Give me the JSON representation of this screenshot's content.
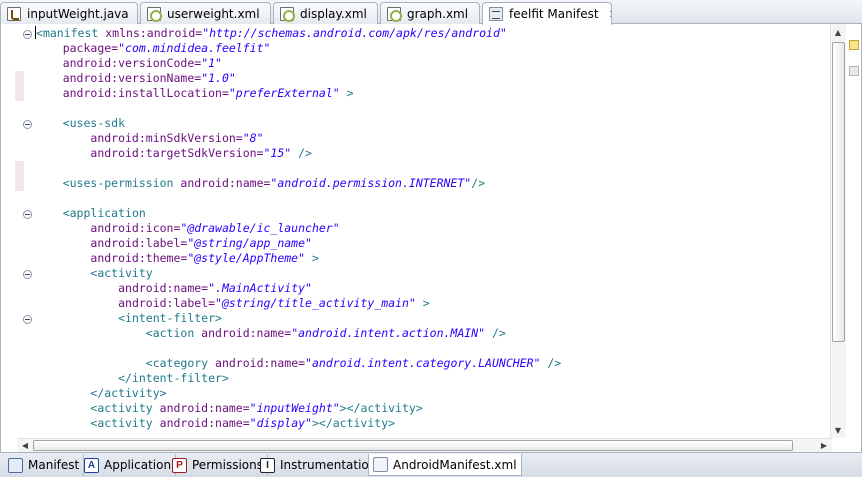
{
  "editor_tabs": [
    {
      "label": "inputWeight.java",
      "icon": "java-file-icon"
    },
    {
      "label": "userweight.xml",
      "icon": "xml-file-icon"
    },
    {
      "label": "display.xml",
      "icon": "xml-file-icon"
    },
    {
      "label": "graph.xml",
      "icon": "xml-file-icon"
    },
    {
      "label": "feelfit Manifest",
      "icon": "manifest-file-icon",
      "active": true,
      "close": "✕"
    }
  ],
  "code": {
    "lines": [
      [
        "<",
        "manifest ",
        "xmlns:android=",
        "\"http://schemas.android.com/apk/res/android\"",
        ""
      ],
      [
        "    ",
        "",
        "package=",
        "\"com.mindidea.feelfit\"",
        ""
      ],
      [
        "    ",
        "",
        "android:versionCode=",
        "\"1\"",
        ""
      ],
      [
        "    ",
        "",
        "android:versionName=",
        "\"1.0\"",
        ""
      ],
      [
        "    ",
        "",
        "android:installLocation=",
        "\"preferExternal\"",
        " >"
      ],
      [
        "",
        "",
        "",
        "",
        ""
      ],
      [
        "    ",
        "<uses-sdk",
        "",
        "",
        ""
      ],
      [
        "        ",
        "",
        "android:minSdkVersion=",
        "\"8\"",
        ""
      ],
      [
        "        ",
        "",
        "android:targetSdkVersion=",
        "\"15\"",
        " />"
      ],
      [
        "",
        "",
        "",
        "",
        ""
      ],
      [
        "    ",
        "<uses-permission ",
        "android:name=",
        "\"android.permission.INTERNET\"",
        "/>"
      ],
      [
        "",
        "",
        "",
        "",
        ""
      ],
      [
        "    ",
        "<application",
        "",
        "",
        ""
      ],
      [
        "        ",
        "",
        "android:icon=",
        "\"@drawable/ic_launcher\"",
        ""
      ],
      [
        "        ",
        "",
        "android:label=",
        "\"@string/app_name\"",
        ""
      ],
      [
        "        ",
        "",
        "android:theme=",
        "\"@style/AppTheme\"",
        " >"
      ],
      [
        "        ",
        "<activity",
        "",
        "",
        ""
      ],
      [
        "            ",
        "",
        "android:name=",
        "\".MainActivity\"",
        ""
      ],
      [
        "            ",
        "",
        "android:label=",
        "\"@string/title_activity_main\"",
        " >"
      ],
      [
        "            ",
        "<intent-filter>",
        "",
        "",
        ""
      ],
      [
        "                ",
        "<action ",
        "android:name=",
        "\"android.intent.action.MAIN\"",
        " />"
      ],
      [
        "",
        "",
        "",
        "",
        ""
      ],
      [
        "                ",
        "<category ",
        "android:name=",
        "\"android.intent.category.LAUNCHER\"",
        " />"
      ],
      [
        "            ",
        "</intent-filter>",
        "",
        "",
        ""
      ],
      [
        "        ",
        "</activity>",
        "",
        "",
        ""
      ],
      [
        "        ",
        "<activity ",
        "android:name=",
        "\"inputWeight\"",
        "></activity>"
      ],
      [
        "        ",
        "<activity ",
        "android:name=",
        "\"display\"",
        "></activity>"
      ]
    ]
  },
  "bottom_tabs": [
    {
      "label": "Manifest",
      "icon": "manifest-icon",
      "glyph": ""
    },
    {
      "label": "Application",
      "icon": "application-icon",
      "glyph": "A"
    },
    {
      "label": "Permissions",
      "icon": "permissions-icon",
      "glyph": "P"
    },
    {
      "label": "Instrumentation",
      "icon": "instrumentation-icon",
      "glyph": "I"
    },
    {
      "label": "AndroidManifest.xml",
      "icon": "xml-source-icon",
      "glyph": "",
      "active": true
    }
  ],
  "colors": {
    "tag": "#1f7a8c",
    "attribute": "#6b0e7d",
    "value": "#2a00ff"
  }
}
